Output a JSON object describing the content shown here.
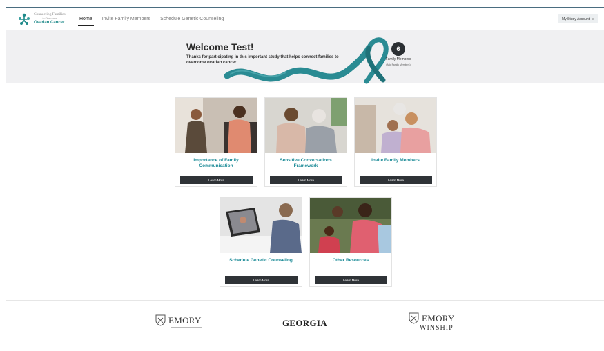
{
  "nav": {
    "brand": {
      "line1": "Connecting Families",
      "line2": "to Overcome",
      "line3": "Ovarian Cancer"
    },
    "links": [
      {
        "label": "Home",
        "active": true
      },
      {
        "label": "Invite Family Members",
        "active": false
      },
      {
        "label": "Schedule Genetic Counseling",
        "active": false
      }
    ],
    "account_label": "My Study Account"
  },
  "hero": {
    "title": "Welcome Test!",
    "subtitle": "Thanks for participating in this important study that helps connect families to overcome ovarian cancer.",
    "family_count": "6",
    "family_label": "Family Members",
    "add_link": "(Add Family Members)"
  },
  "cards": [
    {
      "title": "Importance of Family Communication",
      "button": "Learn More"
    },
    {
      "title": "Sensitive Conversations Framework",
      "button": "Learn More"
    },
    {
      "title": "Invite Family Members",
      "button": "Learn More"
    },
    {
      "title": "Schedule Genetic Counseling",
      "button": "Learn More"
    },
    {
      "title": "Other Resources",
      "button": "Learn More"
    }
  ],
  "footer": {
    "logo1": "EMORY",
    "logo2": "GEORGIA",
    "logo3": "EMORY",
    "logo3_sub": "WINSHIP"
  },
  "colors": {
    "accent": "#1a8a96",
    "ribbon": "#2a8b93",
    "button": "#2f3337",
    "hero_bg": "#f0f0f2"
  }
}
